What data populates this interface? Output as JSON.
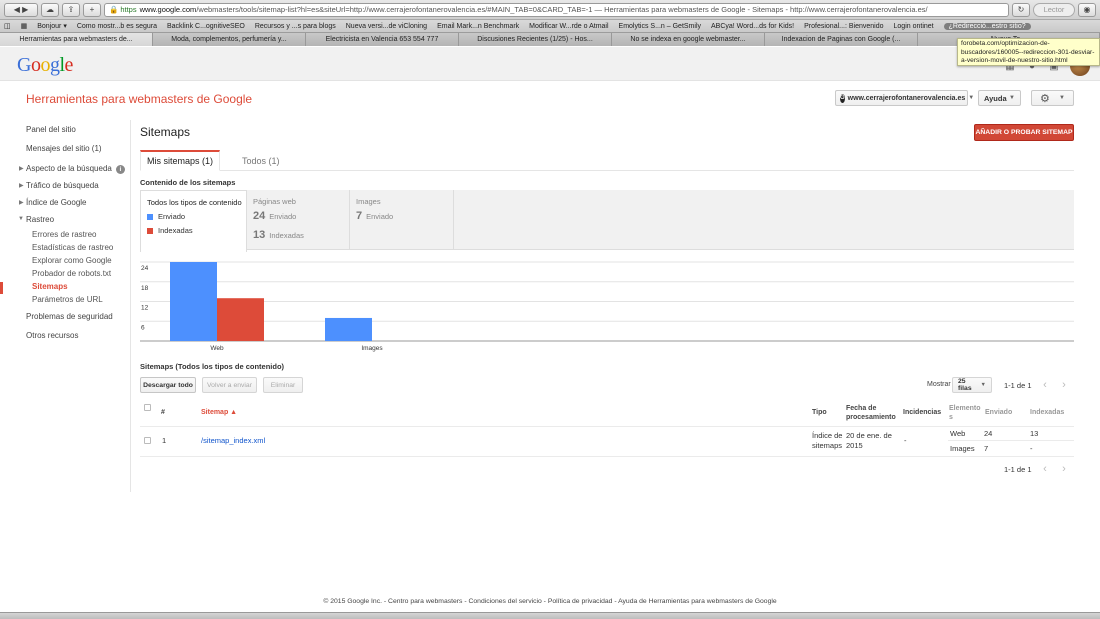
{
  "browser": {
    "url_host": "www.google.com",
    "url_rest": "/webmasters/tools/sitemap-list?hl=es&siteUrl=http://www.cerrajerofontanerovalencia.es/#MAIN_TAB=0&CARD_TAB=-1 — Herramientas para webmasters de Google - Sitemaps - http://www.cerrajerofontanerovalencia.es/",
    "url_scheme": "https",
    "reader_label": "Lector",
    "bookmarks": [
      "Bonjour ▾",
      "Como mostr...b es segura",
      "Backlink C...ognitiveSEO",
      "Recursos y ...s para blogs",
      "Nueva versi...de viCloning",
      "Email Mark...n Benchmark",
      "Modificar W...rde o Atmail",
      "Emolytics S...n – GetSmily",
      "ABCya! Word...ds for Kids!",
      "Profesional...: Bienvenido",
      "Login ontinet",
      "¿Redirecció...estro sitio?"
    ],
    "tabs": [
      "Herramientas para webmasters de...",
      "Moda, complementos, perfumería y...",
      "Electricista en Valencia 653 554 777",
      "Discusiones Recientes (1/25) - Hos...",
      "No se indexa en google webmaster...",
      "Indexacion de Paginas con Google (...",
      "Nuevo Te..."
    ],
    "tooltip": "forobeta.com/optimizacion-de-buscadores/160005--redireccion-301-desviar-a-version-movil-de-nuestro-sitio.html"
  },
  "app": {
    "title": "Herramientas para webmasters de Google",
    "site": "www.cerrajerofontanerovalencia.es",
    "help_label": "Ayuda"
  },
  "sidebar": {
    "items": [
      {
        "label": "Panel del sitio"
      },
      {
        "label": "Mensajes del sitio (1)"
      },
      {
        "label": "Aspecto de la búsqueda"
      },
      {
        "label": "Tráfico de búsqueda"
      },
      {
        "label": "Índice de Google"
      },
      {
        "label": "Rastreo"
      },
      {
        "label": "Errores de rastreo"
      },
      {
        "label": "Estadísticas de rastreo"
      },
      {
        "label": "Explorar como Google"
      },
      {
        "label": "Probador de robots.txt"
      },
      {
        "label": "Sitemaps"
      },
      {
        "label": "Parámetros de URL"
      },
      {
        "label": "Problemas de seguridad"
      },
      {
        "label": "Otros recursos"
      }
    ]
  },
  "main": {
    "title": "Sitemaps",
    "add_button": "AÑADIR O PROBAR SITEMAP",
    "tabs": [
      "Mis sitemaps (1)",
      "Todos (1)"
    ],
    "content_heading": "Contenido de los sitemaps",
    "cards": {
      "all": {
        "title": "Todos los tipos de contenido",
        "legend_sent": "Enviado",
        "legend_indexed": "Indexadas"
      },
      "web": {
        "title": "Páginas web",
        "sent": "24",
        "sent_label": "Enviado",
        "indexed": "13",
        "indexed_label": "Indexadas"
      },
      "images": {
        "title": "Images",
        "sent": "7",
        "sent_label": "Enviado"
      }
    },
    "table_heading": "Sitemaps (Todos los tipos de contenido)",
    "buttons": {
      "download": "Descargar todo",
      "resend": "Volver a enviar",
      "delete": "Eliminar"
    },
    "show_label": "Mostrar",
    "rows_option": "25 filas",
    "pager": "1-1 de 1",
    "columns": {
      "num": "#",
      "sitemap": "Sitemap ▲",
      "type": "Tipo",
      "date": "Fecha de procesamiento",
      "issues": "Incidencias",
      "elements": "Elementos",
      "sent": "Enviado",
      "indexed": "Indexadas"
    },
    "row": {
      "num": "1",
      "sitemap": "/sitemap_index.xml",
      "type": "Índice de sitemaps",
      "date": "20 de ene. de 2015",
      "issues": "-",
      "elements": [
        {
          "name": "Web",
          "sent": "24",
          "indexed": "13"
        },
        {
          "name": "Images",
          "sent": "7",
          "indexed": "-"
        }
      ]
    }
  },
  "chart_data": {
    "type": "bar",
    "categories": [
      "Web",
      "Images"
    ],
    "series": [
      {
        "name": "Enviado",
        "values": [
          24,
          7
        ],
        "color": "#4d90fe"
      },
      {
        "name": "Indexadas",
        "values": [
          13,
          0
        ],
        "color": "#dd4b39"
      }
    ],
    "yticks": [
      6,
      12,
      18,
      24
    ],
    "ylim": [
      0,
      24
    ]
  },
  "footer": "© 2015 Google Inc. - Centro para webmasters - Condiciones del servicio - Política de privacidad - Ayuda de Herramientas para webmasters de Google"
}
